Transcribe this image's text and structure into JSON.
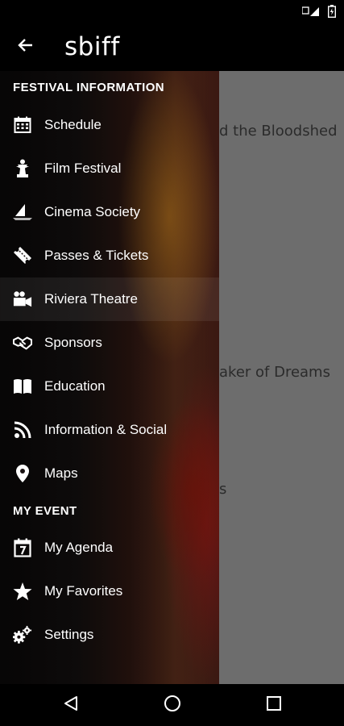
{
  "app": {
    "title": "sbiff"
  },
  "background": {
    "row1": "d the Bloodshed",
    "row2": "aker of Dreams",
    "row3": "s"
  },
  "drawer": {
    "sections": [
      {
        "header": "FESTIVAL INFORMATION",
        "items": [
          {
            "label": "Schedule",
            "icon": "calendar-icon"
          },
          {
            "label": "Film Festival",
            "icon": "oscar-statue-icon"
          },
          {
            "label": "Cinema Society",
            "icon": "sailboat-icon"
          },
          {
            "label": "Passes & Tickets",
            "icon": "ticket-icon"
          },
          {
            "label": "Riviera Theatre",
            "icon": "projector-icon",
            "active": true
          },
          {
            "label": "Sponsors",
            "icon": "handshake-icon"
          },
          {
            "label": "Education",
            "icon": "book-icon"
          },
          {
            "label": "Information & Social",
            "icon": "rss-icon"
          },
          {
            "label": "Maps",
            "icon": "map-pin-icon"
          }
        ]
      },
      {
        "header": "MY EVENT",
        "items": [
          {
            "label": "My Agenda",
            "icon": "agenda-calendar-icon"
          },
          {
            "label": "My Favorites",
            "icon": "star-icon"
          },
          {
            "label": "Settings",
            "icon": "gears-icon"
          }
        ]
      }
    ]
  },
  "colors": {
    "drawer_text": "#ffffff",
    "scrim": "#6d6d6d",
    "bars": "#000000"
  }
}
